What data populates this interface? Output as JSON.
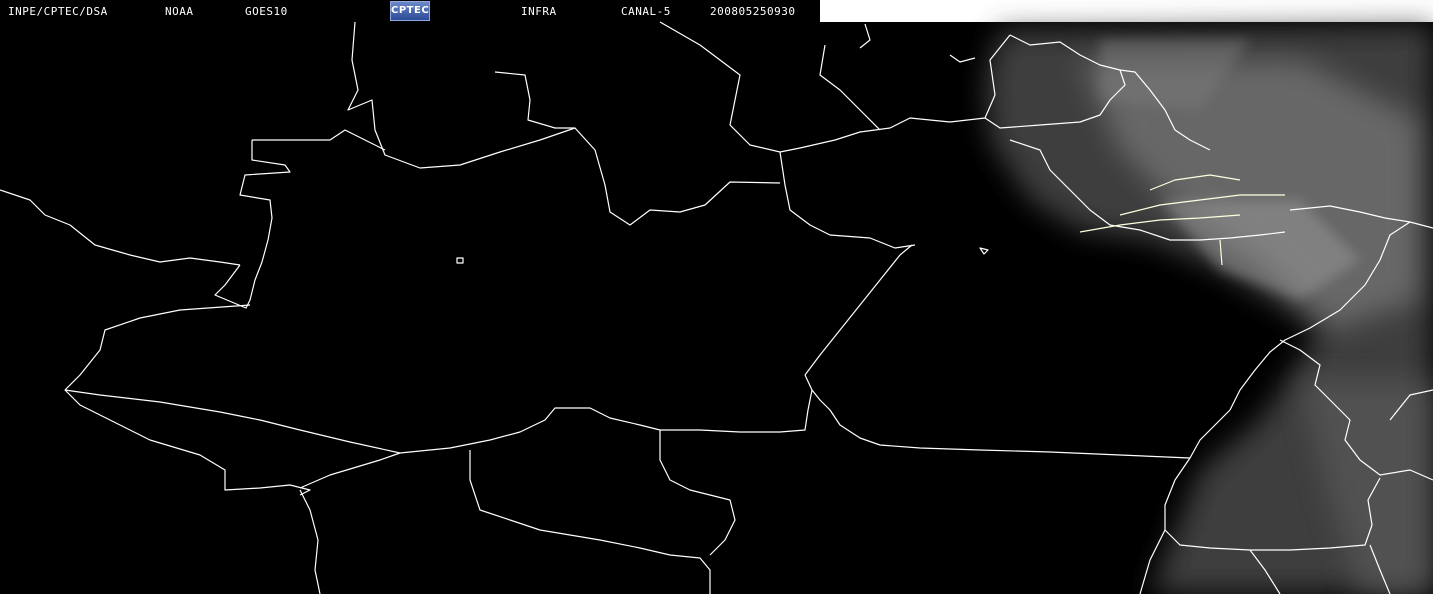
{
  "header": {
    "org": "INPE/CPTEC/DSA",
    "agency": "NOAA",
    "satellite": "GOES10",
    "logo_text": "CPTEC",
    "product": "INFRA",
    "channel": "CANAL-5",
    "timestamp": "200805250930"
  },
  "colors": {
    "background": "#000000",
    "boundary": "#ffffff",
    "cloud": "#6a6a6a",
    "header_bar": "#ffffff"
  }
}
